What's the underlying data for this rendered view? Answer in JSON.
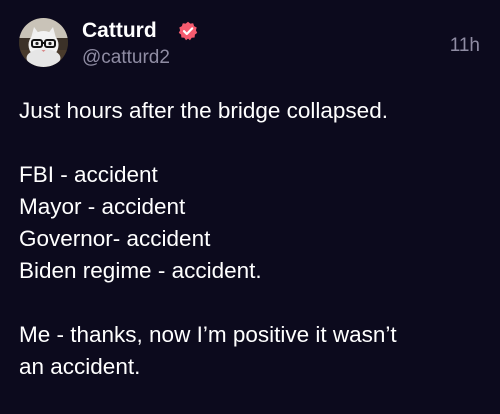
{
  "post": {
    "author": {
      "display_name": "Catturd",
      "handle": "@catturd2",
      "verified": true,
      "verified_color": "#f65b6f",
      "avatar_icon": "cat-avatar-icon"
    },
    "timestamp": "11h",
    "lines": [
      "Just hours after the bridge collapsed.",
      "",
      "FBI - accident",
      "Mayor - accident",
      "Governor- accident",
      "Biden regime - accident.",
      "",
      "Me - thanks, now I’m positive it wasn’t",
      "an accident."
    ]
  },
  "colors": {
    "background": "#0c0a1d",
    "text": "#ffffff",
    "muted": "#8f8ca3"
  }
}
